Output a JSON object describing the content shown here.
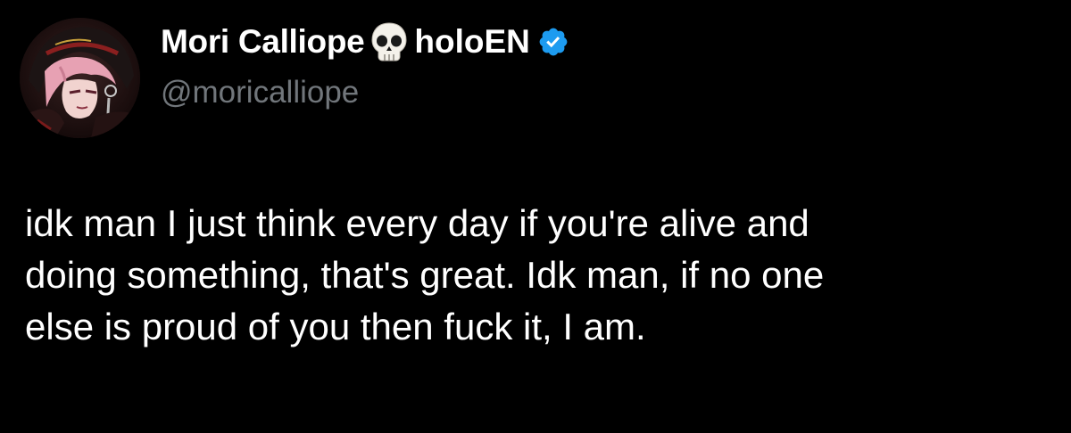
{
  "tweet": {
    "author": {
      "display_name": "Mori Calliope",
      "name_emoji": "skull-icon",
      "name_suffix": "holoEN",
      "verified": true,
      "verified_badge": "verified-icon",
      "handle": "@moricalliope",
      "avatar": "avatar"
    },
    "text_lines": [
      "idk man I just think every day if you're alive and",
      "doing something, that's great. Idk man, if no one",
      "else is proud of you then fuck it, I am."
    ]
  },
  "colors": {
    "background": "#000000",
    "text": "#ffffff",
    "handle": "#71767b",
    "verified": "#1d9bf0"
  }
}
